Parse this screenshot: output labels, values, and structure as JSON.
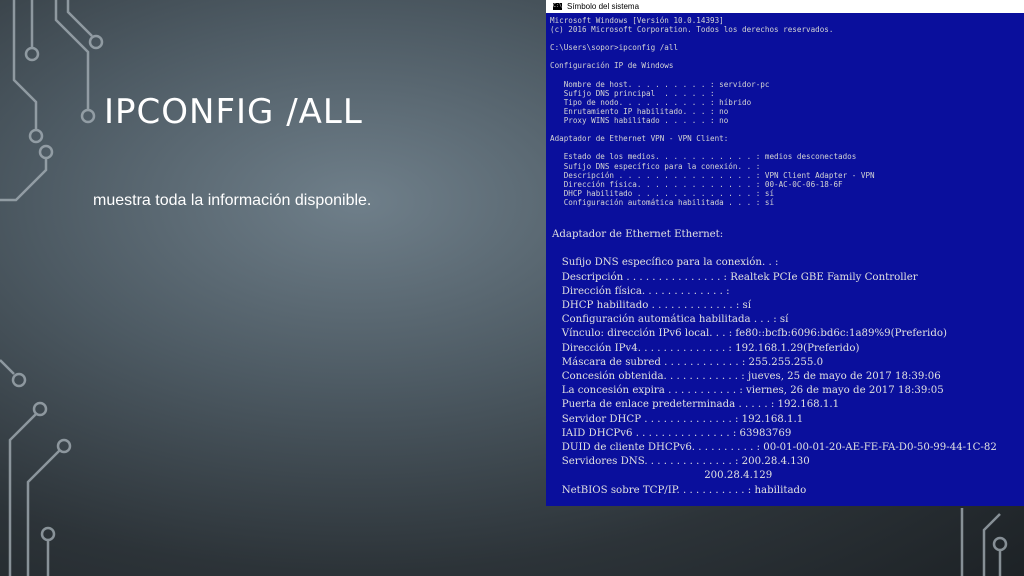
{
  "slide": {
    "title": "IPCONFIG /ALL",
    "subtitle": "muestra toda la información disponible."
  },
  "window": {
    "title": "Símbolo del sistema",
    "icon": "cmd-icon"
  },
  "console_top": "Microsoft Windows [Versión 10.0.14393]\n(c) 2016 Microsoft Corporation. Todos los derechos reservados.\n\nC:\\Users\\sopor>ipconfig /all\n\nConfiguración IP de Windows\n\n   Nombre de host. . . . . . . . . : servidor-pc\n   Sufijo DNS principal  . . . . . :\n   Tipo de nodo. . . . . . . . . . : híbrido\n   Enrutamiento IP habilitado. . . : no\n   Proxy WINS habilitado . . . . . : no\n\nAdaptador de Ethernet VPN - VPN Client:\n\n   Estado de los medios. . . . . . . . . . . : medios desconectados\n   Sufijo DNS específico para la conexión. . :\n   Descripción . . . . . . . . . . . . . . . : VPN Client Adapter - VPN\n   Dirección física. . . . . . . . . . . . . : 00-AC-0C-06-18-6F\n   DHCP habilitado . . . . . . . . . . . . . : sí\n   Configuración automática habilitada . . . : sí",
  "console_bottom": "Adaptador de Ethernet Ethernet:\n\n   Sufijo DNS específico para la conexión. . :\n   Descripción . . . . . . . . . . . . . . . : Realtek PCIe GBE Family Controller\n   Dirección física. . . . . . . . . . . . . :\n   DHCP habilitado . . . . . . . . . . . . . : sí\n   Configuración automática habilitada . . . : sí\n   Vínculo: dirección IPv6 local. . . : fe80::bcfb:6096:bd6c:1a89%9(Preferido)\n   Dirección IPv4. . . . . . . . . . . . . . : 192.168.1.29(Preferido)\n   Máscara de subred . . . . . . . . . . . . : 255.255.255.0\n   Concesión obtenida. . . . . . . . . . . . : jueves, 25 de mayo de 2017 18:39:06\n   La concesión expira . . . . . . . . . . . : viernes, 26 de mayo de 2017 18:39:05\n   Puerta de enlace predeterminada . . . . . : 192.168.1.1\n   Servidor DHCP . . . . . . . . . . . . . . : 192.168.1.1\n   IAID DHCPv6 . . . . . . . . . . . . . . . : 63983769\n   DUID de cliente DHCPv6. . . . . . . . . . : 00-01-00-01-20-AE-FE-FA-D0-50-99-44-1C-82\n   Servidores DNS. . . . . . . . . . . . . . : 200.28.4.130\n                                               200.28.4.129\n   NetBIOS sobre TCP/IP. . . . . . . . . . . : habilitado"
}
